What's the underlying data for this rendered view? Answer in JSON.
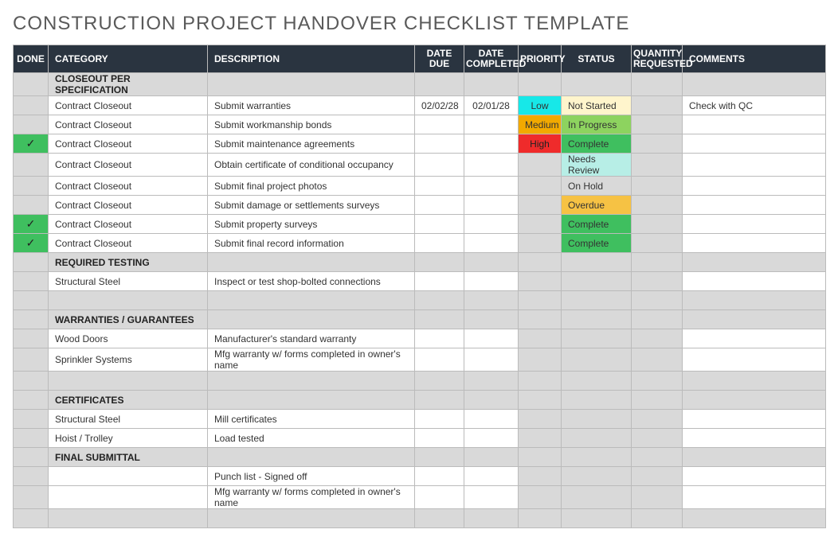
{
  "title": "CONSTRUCTION PROJECT HANDOVER CHECKLIST TEMPLATE",
  "headers": {
    "done": "DONE",
    "category": "CATEGORY",
    "description": "DESCRIPTION",
    "date_due": "DATE DUE",
    "date_completed": "DATE COMPLETED",
    "priority": "PRIORITY",
    "status": "STATUS",
    "qty": "QUANTITY REQUESTED",
    "comments": "COMMENTS"
  },
  "sections": {
    "s0": "CLOSEOUT PER SPECIFICATION",
    "s1": "REQUIRED TESTING",
    "s2": "WARRANTIES / GUARANTEES",
    "s3": "CERTIFICATES",
    "s4": "FINAL SUBMITTAL"
  },
  "rows": {
    "r0": {
      "done": "",
      "cat": "Contract Closeout",
      "desc": "Submit warranties",
      "due": "02/02/28",
      "comp": "02/01/28",
      "pri": "Low",
      "stat": "Not Started",
      "comm": "Check with QC"
    },
    "r1": {
      "done": "",
      "cat": "Contract Closeout",
      "desc": "Submit workmanship bonds",
      "due": "",
      "comp": "",
      "pri": "Medium",
      "stat": "In Progress",
      "comm": ""
    },
    "r2": {
      "done": "✓",
      "cat": "Contract Closeout",
      "desc": "Submit maintenance agreements",
      "due": "",
      "comp": "",
      "pri": "High",
      "stat": "Complete",
      "comm": ""
    },
    "r3": {
      "done": "",
      "cat": "Contract Closeout",
      "desc": "Obtain certificate of conditional occupancy",
      "due": "",
      "comp": "",
      "pri": "",
      "stat": "Needs Review",
      "comm": ""
    },
    "r4": {
      "done": "",
      "cat": "Contract Closeout",
      "desc": "Submit final project photos",
      "due": "",
      "comp": "",
      "pri": "",
      "stat": "On Hold",
      "comm": ""
    },
    "r5": {
      "done": "",
      "cat": "Contract Closeout",
      "desc": "Submit damage or settlements surveys",
      "due": "",
      "comp": "",
      "pri": "",
      "stat": "Overdue",
      "comm": ""
    },
    "r6": {
      "done": "✓",
      "cat": "Contract Closeout",
      "desc": "Submit property surveys",
      "due": "",
      "comp": "",
      "pri": "",
      "stat": "Complete",
      "comm": ""
    },
    "r7": {
      "done": "✓",
      "cat": "Contract Closeout",
      "desc": "Submit final record information",
      "due": "",
      "comp": "",
      "pri": "",
      "stat": "Complete",
      "comm": ""
    },
    "r8": {
      "done": "",
      "cat": "Structural Steel",
      "desc": "Inspect or test shop-bolted connections",
      "due": "",
      "comp": "",
      "pri": "",
      "stat": "",
      "comm": ""
    },
    "r9": {
      "done": "",
      "cat": "Wood Doors",
      "desc": "Manufacturer's standard warranty",
      "due": "",
      "comp": "",
      "pri": "",
      "stat": "",
      "comm": ""
    },
    "r10": {
      "done": "",
      "cat": "Sprinkler Systems",
      "desc": "Mfg warranty w/ forms completed in owner's name",
      "due": "",
      "comp": "",
      "pri": "",
      "stat": "",
      "comm": ""
    },
    "r11": {
      "done": "",
      "cat": "Structural Steel",
      "desc": "Mill certificates",
      "due": "",
      "comp": "",
      "pri": "",
      "stat": "",
      "comm": ""
    },
    "r12": {
      "done": "",
      "cat": "Hoist / Trolley",
      "desc": "Load tested",
      "due": "",
      "comp": "",
      "pri": "",
      "stat": "",
      "comm": ""
    },
    "r13": {
      "done": "",
      "cat": "",
      "desc": "Punch list - Signed off",
      "due": "",
      "comp": "",
      "pri": "",
      "stat": "",
      "comm": ""
    },
    "r14": {
      "done": "",
      "cat": "",
      "desc": "Mfg warranty w/ forms completed in owner's name",
      "due": "",
      "comp": "",
      "pri": "",
      "stat": "",
      "comm": ""
    }
  }
}
